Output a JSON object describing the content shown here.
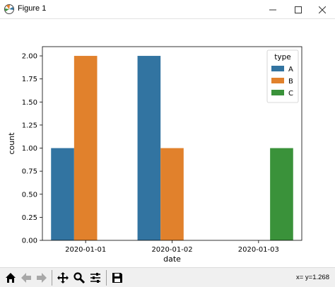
{
  "window": {
    "title": "Figure 1"
  },
  "colors": {
    "A": "#3274a1",
    "B": "#e1812c",
    "C": "#3a923a"
  },
  "toolbar": {
    "buttons": [
      "home-icon",
      "back-arrow-icon",
      "forward-arrow-icon",
      "pan-icon",
      "zoom-icon",
      "subplots-icon",
      "save-icon"
    ],
    "coords_x": "x=",
    "coords_y": "y=1.268"
  },
  "chart_data": {
    "type": "bar",
    "title": "",
    "xlabel": "date",
    "ylabel": "count",
    "categories": [
      "2020-01-01",
      "2020-01-02",
      "2020-01-03"
    ],
    "ylim": [
      0,
      2.1
    ],
    "yticks": [
      "0.00",
      "0.25",
      "0.50",
      "0.75",
      "1.00",
      "1.25",
      "1.50",
      "1.75",
      "2.00"
    ],
    "series": [
      {
        "name": "A",
        "values": [
          1,
          2,
          0
        ]
      },
      {
        "name": "B",
        "values": [
          2,
          1,
          0
        ]
      },
      {
        "name": "C",
        "values": [
          0,
          0,
          1
        ]
      }
    ],
    "legend": {
      "title": "type",
      "placement": "top-right"
    },
    "grid": false
  }
}
